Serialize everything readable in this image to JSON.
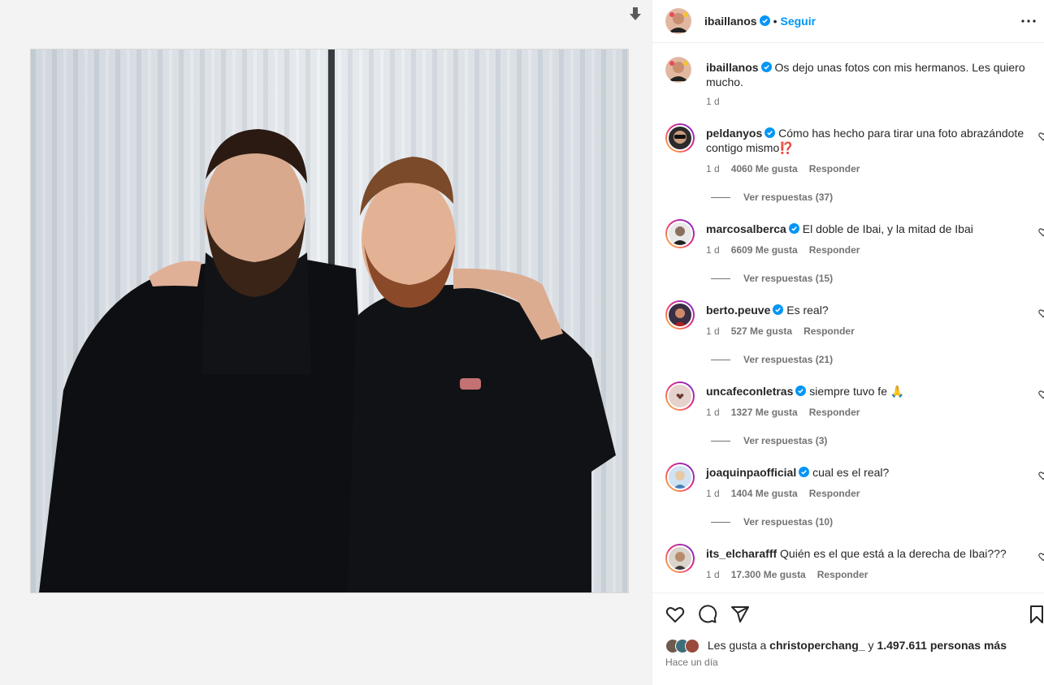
{
  "post": {
    "author": "ibaillanos",
    "follow_label": "Seguir",
    "separator": "•",
    "caption": "Os dejo unas fotos con mis hermanos. Les quiero mucho.",
    "caption_time": "1 d"
  },
  "comments": [
    {
      "user": "peldanyos",
      "text": "Cómo has hecho para tirar una foto abrazándote contigo mismo⁉️",
      "time": "1 d",
      "likes": "4060 Me gusta",
      "reply": "Responder",
      "replies": "Ver respuestas (37)"
    },
    {
      "user": "marcosalberca",
      "text": "El doble de Ibai, y la mitad de Ibai",
      "time": "1 d",
      "likes": "6609 Me gusta",
      "reply": "Responder",
      "replies": "Ver respuestas (15)"
    },
    {
      "user": "berto.peuve",
      "text": "Es real?",
      "time": "1 d",
      "likes": "527 Me gusta",
      "reply": "Responder",
      "replies": "Ver respuestas (21)"
    },
    {
      "user": "uncafeconletras",
      "text": "siempre tuvo fe 🙏",
      "time": "1 d",
      "likes": "1327 Me gusta",
      "reply": "Responder",
      "replies": "Ver respuestas (3)"
    },
    {
      "user": "joaquinpaofficial",
      "text": "cual es el real?",
      "time": "1 d",
      "likes": "1404 Me gusta",
      "reply": "Responder",
      "replies": "Ver respuestas (10)"
    },
    {
      "user": "its_elcharafff",
      "text": "Quién es el que está a la derecha de Ibai???",
      "time": "1 d",
      "likes": "17.300 Me gusta",
      "reply": "Responder"
    }
  ],
  "likes": {
    "prefix": "Les gusta a",
    "user": "christoperchang_",
    "joiner": "y",
    "count": "1.497.611 personas más"
  },
  "posted_ago": "Hace un día",
  "colors": {
    "verified": "#0095f6",
    "link": "#0095f6",
    "muted": "#737373"
  }
}
